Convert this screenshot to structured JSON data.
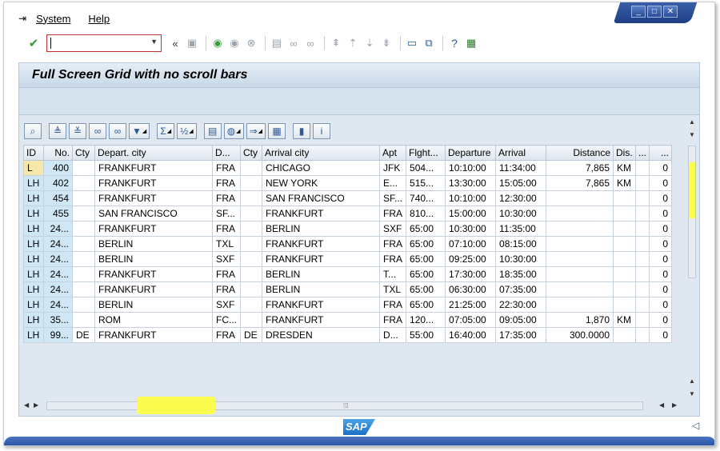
{
  "window_controls": [
    "_",
    "□",
    "✕"
  ],
  "menu": [
    {
      "label": "System"
    },
    {
      "label": "Help"
    }
  ],
  "toolbar": {
    "command_field_value": "",
    "icons": [
      "enter-icon",
      "command-field",
      "back-arrows-icon",
      "save-icon",
      "back-icon",
      "exit-icon",
      "cancel-icon",
      "print-icon",
      "find-icon",
      "find-next-icon",
      "first-page-icon",
      "prev-page-icon",
      "next-page-icon",
      "last-page-icon",
      "new-session-icon",
      "shortcut-icon",
      "help-icon",
      "layout-icon"
    ]
  },
  "page_title": "Full Screen Grid with no scroll bars",
  "grid_toolbar": [
    "details-icon",
    "sort-asc-icon",
    "sort-desc-icon",
    "find-icon",
    "find-next-icon",
    "filter-icon",
    "sum-icon",
    "subtotal-icon",
    "print-icon",
    "views-icon",
    "export-icon",
    "layout-icon",
    "graphic-icon",
    "info-icon"
  ],
  "columns": [
    {
      "label": "ID",
      "align": "l"
    },
    {
      "label": "No.",
      "align": "r"
    },
    {
      "label": "Cty",
      "align": "l"
    },
    {
      "label": "Depart. city",
      "align": "l"
    },
    {
      "label": "D...",
      "align": "l"
    },
    {
      "label": "Cty",
      "align": "l"
    },
    {
      "label": "Arrival city",
      "align": "l"
    },
    {
      "label": "Apt",
      "align": "l"
    },
    {
      "label": "Flght...",
      "align": "l"
    },
    {
      "label": "Departure",
      "align": "l"
    },
    {
      "label": "Arrival",
      "align": "l"
    },
    {
      "label": "Distance",
      "align": "r"
    },
    {
      "label": "Dis.",
      "align": "l"
    },
    {
      "label": "...",
      "align": "l"
    },
    {
      "label": "...",
      "align": "r"
    }
  ],
  "rows": [
    [
      "L",
      "400",
      "",
      "FRANKFURT",
      "FRA",
      "",
      "CHICAGO",
      "JFK",
      "504...",
      "10:10:00",
      "11:34:00",
      "7,865",
      "KM",
      "",
      "0"
    ],
    [
      "LH",
      "402",
      "",
      "FRANKFURT",
      "FRA",
      "",
      "NEW YORK",
      "E...",
      "515...",
      "13:30:00",
      "15:05:00",
      "7,865",
      "KM",
      "",
      "0"
    ],
    [
      "LH",
      "454",
      "",
      "FRANKFURT",
      "FRA",
      "",
      "SAN FRANCISCO",
      "SF...",
      "740...",
      "10:10:00",
      "12:30:00",
      "",
      "",
      "",
      "0"
    ],
    [
      "LH",
      "455",
      "",
      "SAN FRANCISCO",
      "SF...",
      "",
      "FRANKFURT",
      "FRA",
      "810...",
      "15:00:00",
      "10:30:00",
      "",
      "",
      "",
      "0"
    ],
    [
      "LH",
      "24...",
      "",
      "FRANKFURT",
      "FRA",
      "",
      "BERLIN",
      "SXF",
      "65:00",
      "10:30:00",
      "11:35:00",
      "",
      "",
      "",
      "0"
    ],
    [
      "LH",
      "24...",
      "",
      "BERLIN",
      "TXL",
      "",
      "FRANKFURT",
      "FRA",
      "65:00",
      "07:10:00",
      "08:15:00",
      "",
      "",
      "",
      "0"
    ],
    [
      "LH",
      "24...",
      "",
      "BERLIN",
      "SXF",
      "",
      "FRANKFURT",
      "FRA",
      "65:00",
      "09:25:00",
      "10:30:00",
      "",
      "",
      "",
      "0"
    ],
    [
      "LH",
      "24...",
      "",
      "FRANKFURT",
      "FRA",
      "",
      "BERLIN",
      "T...",
      "65:00",
      "17:30:00",
      "18:35:00",
      "",
      "",
      "",
      "0"
    ],
    [
      "LH",
      "24...",
      "",
      "FRANKFURT",
      "FRA",
      "",
      "BERLIN",
      "TXL",
      "65:00",
      "06:30:00",
      "07:35:00",
      "",
      "",
      "",
      "0"
    ],
    [
      "LH",
      "24...",
      "",
      "BERLIN",
      "SXF",
      "",
      "FRANKFURT",
      "FRA",
      "65:00",
      "21:25:00",
      "22:30:00",
      "",
      "",
      "",
      "0"
    ],
    [
      "LH",
      "35...",
      "",
      "ROM",
      "FC...",
      "",
      "FRANKFURT",
      "FRA",
      "120...",
      "07:05:00",
      "09:05:00",
      "1,870",
      "KM",
      "",
      "0"
    ],
    [
      "LH",
      "99...",
      "DE",
      "FRANKFURT",
      "FRA",
      "DE",
      "DRESDEN",
      "D...",
      "55:00",
      "16:40:00",
      "17:35:00",
      "300.0000",
      "",
      "",
      "0"
    ]
  ],
  "logo_text": "SAP",
  "colors": {
    "highlight": "#ffff33",
    "key_cell": "#cfe6f5",
    "selected_cell": "#f7e7a8",
    "status_bar": "#244f9e"
  }
}
